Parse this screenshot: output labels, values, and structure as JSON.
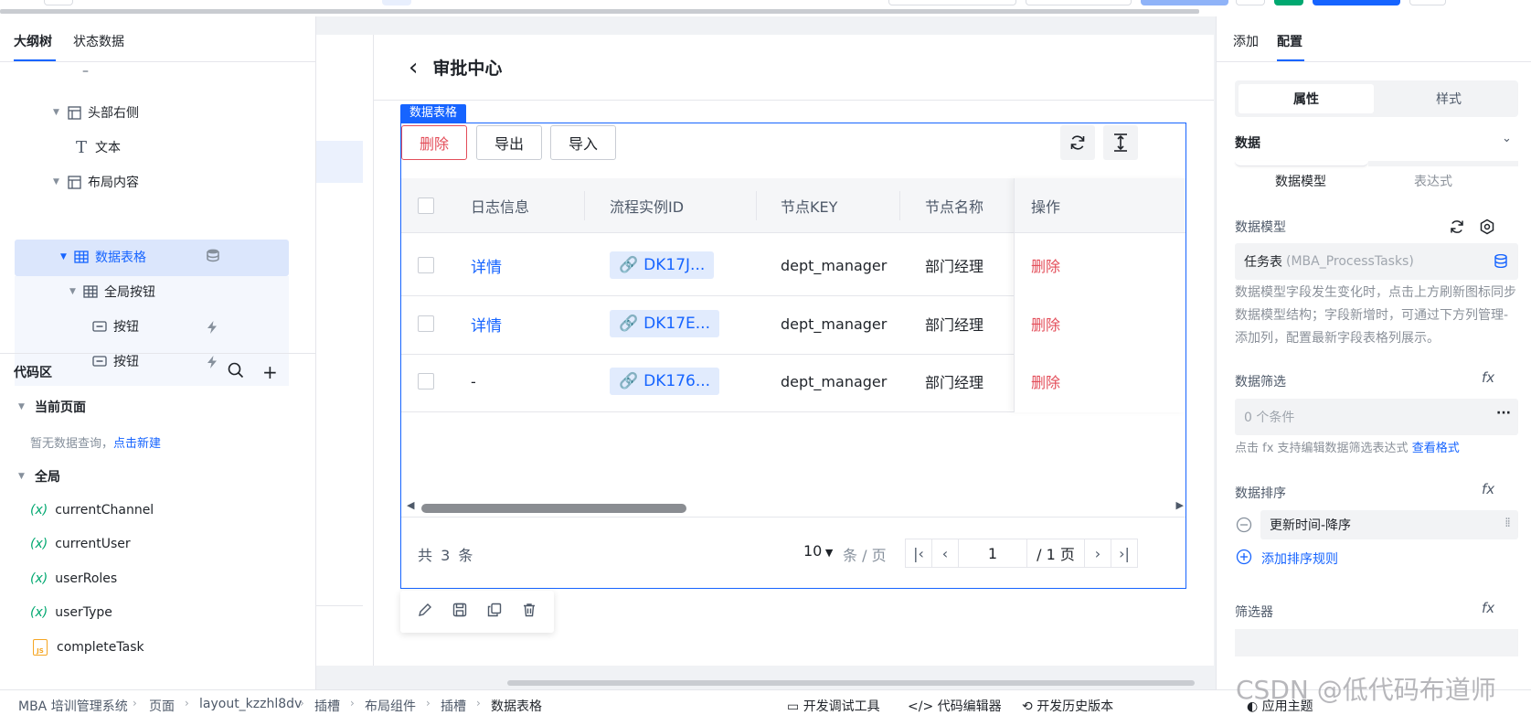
{
  "left_panel": {
    "tabs": [
      "大纲树",
      "状态数据"
    ],
    "tree": [
      {
        "label": "–",
        "icon": "dash-icon"
      },
      {
        "label": "头部右侧",
        "icon": "layout-icon"
      },
      {
        "label": "文本",
        "icon": "text-icon"
      },
      {
        "label": "布局内容",
        "icon": "layout-icon"
      },
      {
        "label": "数据表格",
        "icon": "table-icon",
        "selected": true
      },
      {
        "label": "全局按钮",
        "icon": "table-icon"
      },
      {
        "label": "按钮",
        "icon": "button-icon"
      },
      {
        "label": "按钮",
        "icon": "button-icon"
      }
    ],
    "code_area": {
      "title": "代码区",
      "current_page": "当前页面",
      "empty_hint": "暂无数据查询，",
      "create_link": "点击新建",
      "global": "全局",
      "var_symbol": "(x)",
      "js_badge": "JS",
      "vars": [
        "currentChannel",
        "currentUser",
        "userRoles",
        "userType"
      ],
      "func": "completeTask"
    }
  },
  "page": {
    "back": "‹",
    "title": "审批中心",
    "component_tag": "数据表格",
    "buttons": {
      "delete": "删除",
      "export": "导出",
      "import": "导入"
    },
    "columns": [
      "日志信息",
      "流程实例ID",
      "节点KEY",
      "节点名称",
      "操作"
    ],
    "rows": [
      {
        "log": "详情",
        "instance": "DK17J...",
        "key": "dept_manager",
        "name": "部门经理",
        "op": "删除"
      },
      {
        "log": "详情",
        "instance": "DK17E...",
        "key": "dept_manager",
        "name": "部门经理",
        "op": "删除"
      },
      {
        "log": "-",
        "instance": "DK176...",
        "key": "dept_manager",
        "name": "部门经理",
        "op": "删除"
      }
    ],
    "pager": {
      "total_prefix": "共",
      "total": "3",
      "total_suffix": "条",
      "page_size": "10",
      "page_size_unit": "条 / 页",
      "current_page": "1",
      "total_pages": "/ 1 页"
    }
  },
  "right_panel": {
    "tabs": [
      "添加",
      "配置"
    ],
    "segments": [
      "属性",
      "样式"
    ],
    "section_title": "数据",
    "sub_tabs": [
      "数据模型",
      "表达式"
    ],
    "model_label": "数据模型",
    "model_value": "任务表",
    "model_value_code": "(MBA_ProcessTasks)",
    "model_hint": "数据模型字段发生变化时，点击上方刷新图标同步数据模型结构；字段新增时，可通过下方列管理-添加列，配置最新字段表格列展示。",
    "filter_label": "数据筛选",
    "filter_value": "0 个条件",
    "filter_hint": "点击 fx 支持编辑数据筛选表达式",
    "filter_link": "查看格式",
    "sort_label": "数据排序",
    "sort_value": "更新时间-降序",
    "add_sort": "添加排序规则",
    "selector_label": "筛选器",
    "fx": "fx",
    "more": "···"
  },
  "bottom_bar": {
    "breadcrumb": [
      "MBA 培训管理系统",
      "页面",
      "layout_kzzhl8dv",
      "插槽",
      "布局组件",
      "插槽",
      "数据表格"
    ],
    "tools": [
      "开发调试工具",
      "代码编辑器",
      "开发历史版本",
      "应用主题"
    ]
  },
  "watermark": "CSDN @低代码布道师",
  "colors": {
    "primary": "#1664ff",
    "danger": "#e34d59",
    "selected_bg": "#dbe6fc",
    "var_green": "#00a870"
  }
}
